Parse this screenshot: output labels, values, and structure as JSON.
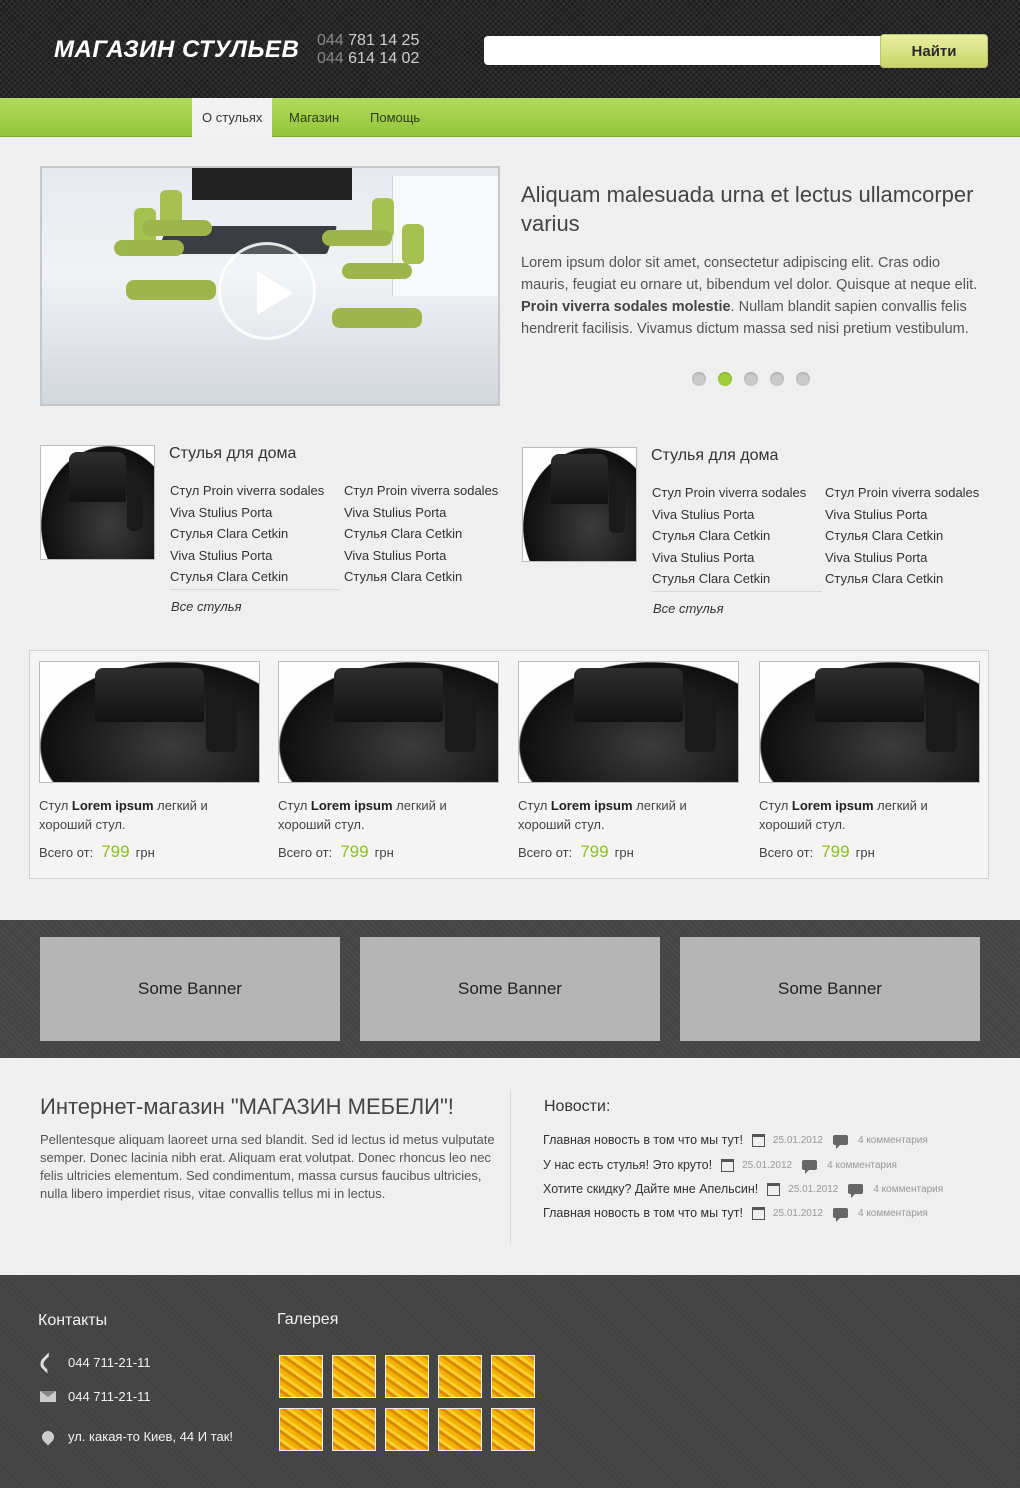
{
  "header": {
    "logo": "МАГАЗИН СТУЛЬЕВ",
    "phones": [
      {
        "code": "044",
        "number": "781 14 25"
      },
      {
        "code": "044",
        "number": "614 14 02"
      }
    ],
    "search": {
      "value": "",
      "placeholder": "",
      "button_label": "Найти"
    }
  },
  "nav": {
    "items": [
      {
        "label": "О стульях",
        "active": true
      },
      {
        "label": "Магазин",
        "active": false
      },
      {
        "label": "Помощь",
        "active": false
      }
    ]
  },
  "slider": {
    "title": "Aliquam malesuada urna et lectus ullamcorper varius",
    "text_before": "Lorem ipsum dolor sit amet, consectetur adipiscing elit. Cras odio mauris, feugiat eu ornare ut, bibendum vel dolor. Quisque at neque elit. ",
    "text_bold": "Proin viverra sodales molestie",
    "text_after": ". Nullam blandit sapien convallis felis hendrerit facilisis. Vivamus dictum massa sed nisi pretium vestibulum.",
    "dots": 5,
    "active_dot": 2
  },
  "categories": [
    {
      "title": "Стулья для дома",
      "col1": [
        "Стул Proin viverra sodales",
        "Viva Stulius Porta",
        "Стулья Clara Cetkin",
        "Viva Stulius Porta",
        "Стулья Clara Cetkin"
      ],
      "col2": [
        "Стул Proin viverra sodales",
        "Viva Stulius Porta",
        "Стулья Clara Cetkin",
        "Viva Stulius Porta",
        "Стулья Clara Cetkin"
      ],
      "all_link": "Все стулья"
    },
    {
      "title": "Стулья для дома",
      "col1": [
        "Стул Proin viverra sodales",
        "Viva Stulius Porta",
        "Стулья Clara Cetkin",
        "Viva Stulius Porta",
        "Стулья Clara Cetkin"
      ],
      "col2": [
        "Стул Proin viverra sodales",
        "Viva Stulius Porta",
        "Стулья Clara Cetkin",
        "Viva Stulius Porta",
        "Стулья Clara Cetkin"
      ],
      "all_link": "Все стулья"
    }
  ],
  "products": [
    {
      "prefix": "Стул ",
      "bold": "Lorem ipsum",
      "suffix": " легкий и хороший стул.",
      "price_label": "Всего от:",
      "price": "799",
      "currency": "грн"
    },
    {
      "prefix": "Стул ",
      "bold": "Lorem ipsum",
      "suffix": " легкий и хороший стул.",
      "price_label": "Всего от:",
      "price": "799",
      "currency": "грн"
    },
    {
      "prefix": "Стул ",
      "bold": "Lorem ipsum",
      "suffix": " легкий и хороший стул.",
      "price_label": "Всего от:",
      "price": "799",
      "currency": "грн"
    },
    {
      "prefix": "Стул ",
      "bold": "Lorem ipsum",
      "suffix": " легкий и хороший стул.",
      "price_label": "Всего от:",
      "price": "799",
      "currency": "грн"
    }
  ],
  "banners": [
    "Some Banner",
    "Some Banner",
    "Some Banner"
  ],
  "about": {
    "title": "Интернет-магазин \"МАГАЗИН МЕБЕЛИ\"!",
    "text": "Pellentesque aliquam laoreet urna sed blandit. Sed id lectus id metus vulputate semper. Donec lacinia nibh erat. Aliquam erat volutpat. Donec rhoncus leo nec felis ultricies elementum. Sed condimentum, massa cursus faucibus ultricies, nulla libero imperdiet risus, vitae convallis tellus mi in lectus."
  },
  "news": {
    "title": "Новости:",
    "items": [
      {
        "title": "Главная новость в том что мы тут!",
        "date": "25.01.2012",
        "comments": "4 комментария"
      },
      {
        "title": "У нас есть стулья! Это круто!",
        "date": "25.01.2012",
        "comments": "4 комментария"
      },
      {
        "title": "Хотите скидку? Дайте мне Апельсин!",
        "date": "25.01.2012",
        "comments": "4 комментария"
      },
      {
        "title": "Главная новость в том что мы тут!",
        "date": "25.01.2012",
        "comments": "4 комментария"
      }
    ]
  },
  "footer": {
    "contacts_title": "Контакты",
    "phone": "044 711-21-11",
    "email": "044 711-21-11",
    "address": "ул. какая-то Киев, 44 И так!",
    "gallery_title": "Галерея",
    "gallery_count": 10
  },
  "colors": {
    "accent_green": "#9fcf3a",
    "nav_green": "#a6d24c",
    "price_green": "#8cbf1f",
    "header_dark": "#1b1b1b",
    "footer_dark": "#474747"
  },
  "icons": [
    "play-icon",
    "calendar-icon",
    "comment-icon",
    "phone-icon",
    "mail-icon",
    "location-icon"
  ]
}
